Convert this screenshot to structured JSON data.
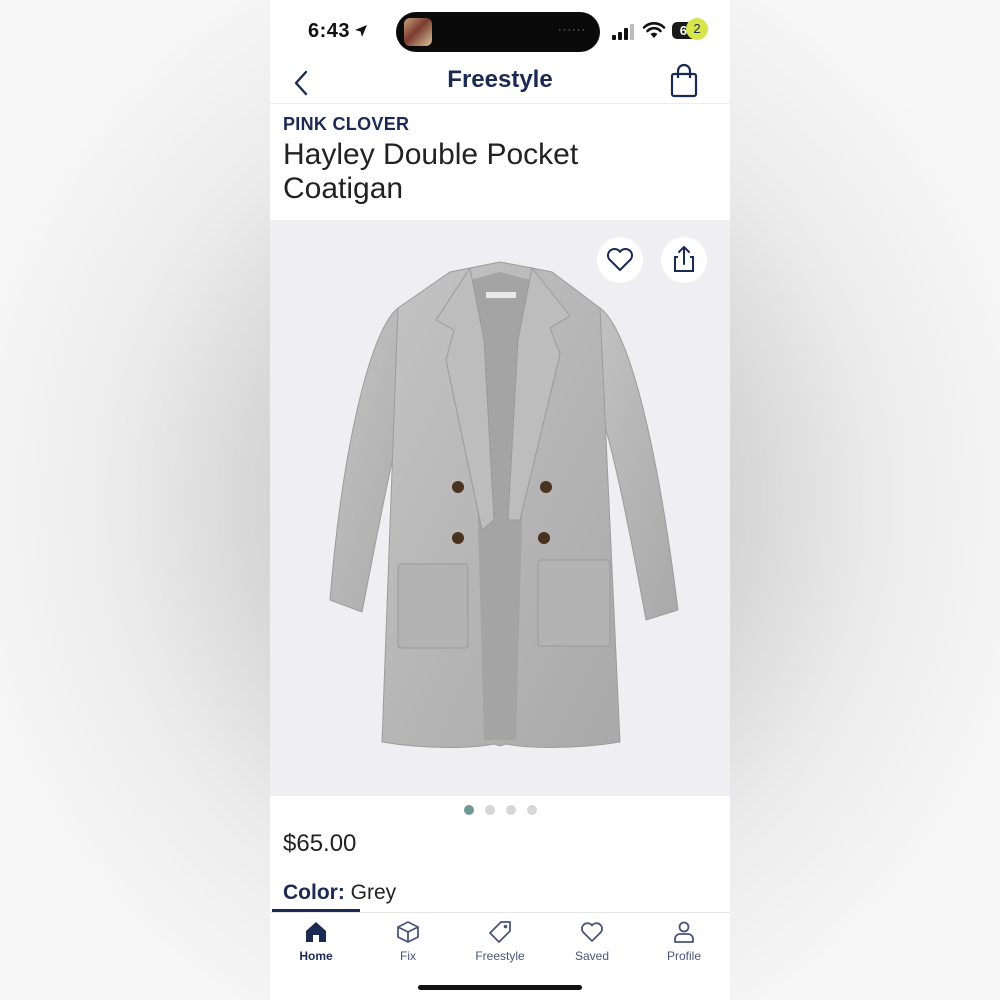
{
  "status_bar": {
    "time": "6:43",
    "battery": "64"
  },
  "header": {
    "title": "Freestyle",
    "bag_count": "2"
  },
  "product": {
    "brand": "PINK CLOVER",
    "name": "Hayley Double Pocket Coatigan",
    "price": "$65.00",
    "color_label": "Color:",
    "color_value": "Grey"
  },
  "gallery": {
    "image_count": 4,
    "active_index": 0
  },
  "tabbar": {
    "items": [
      {
        "label": "Home",
        "icon": "home-icon",
        "active": true
      },
      {
        "label": "Fix",
        "icon": "box-icon",
        "active": false
      },
      {
        "label": "Freestyle",
        "icon": "tag-icon",
        "active": false
      },
      {
        "label": "Saved",
        "icon": "heart-icon",
        "active": false
      },
      {
        "label": "Profile",
        "icon": "person-icon",
        "active": false
      }
    ]
  },
  "colors": {
    "navy": "#1b2a52",
    "badge": "#d6e64a",
    "dot_active": "#6f9a93"
  }
}
